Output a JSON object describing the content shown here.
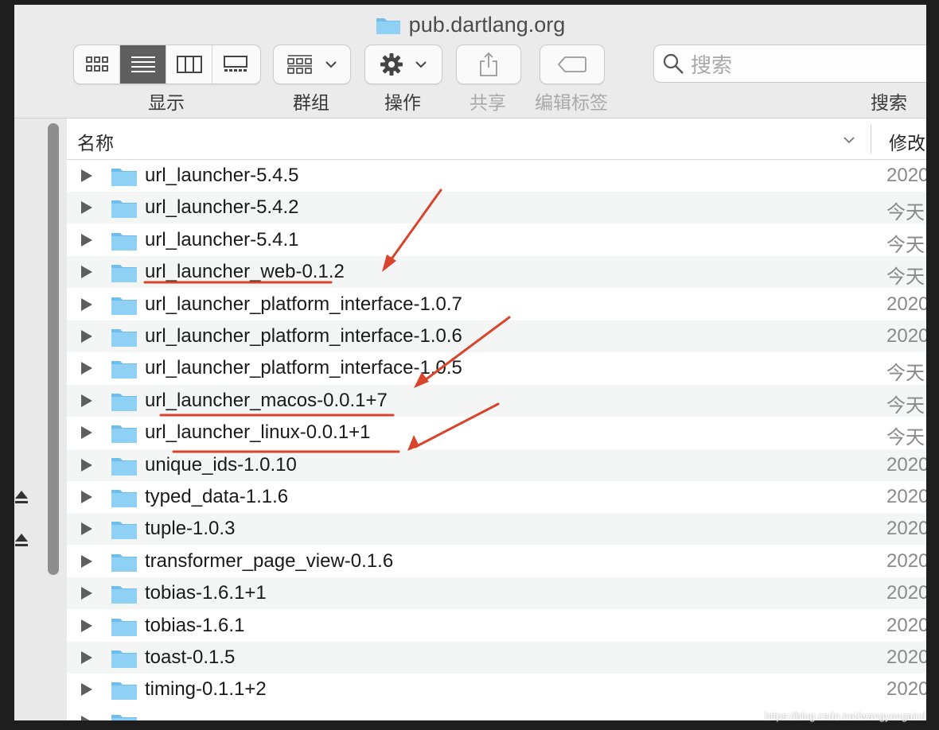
{
  "window": {
    "title": "pub.dartlang.org"
  },
  "toolbar": {
    "view_label": "显示",
    "group_label": "群组",
    "action_label": "操作",
    "share_label": "共享",
    "tags_label": "编辑标签",
    "search_label": "搜索",
    "search_placeholder": "搜索",
    "active_view": "list"
  },
  "columns": {
    "name": "名称",
    "modified": "修改"
  },
  "rows": [
    {
      "name": "url_launcher-5.4.5",
      "date": "2020"
    },
    {
      "name": "url_launcher-5.4.2",
      "date": "今天"
    },
    {
      "name": "url_launcher-5.4.1",
      "date": "今天"
    },
    {
      "name": "url_launcher_web-0.1.2",
      "date": "今天"
    },
    {
      "name": "url_launcher_platform_interface-1.0.7",
      "date": "2020"
    },
    {
      "name": "url_launcher_platform_interface-1.0.6",
      "date": "2020"
    },
    {
      "name": "url_launcher_platform_interface-1.0.5",
      "date": "今天"
    },
    {
      "name": "url_launcher_macos-0.0.1+7",
      "date": "今天"
    },
    {
      "name": "url_launcher_linux-0.0.1+1",
      "date": "今天"
    },
    {
      "name": "unique_ids-1.0.10",
      "date": "2020"
    },
    {
      "name": "typed_data-1.1.6",
      "date": "2020"
    },
    {
      "name": "tuple-1.0.3",
      "date": "2020"
    },
    {
      "name": "transformer_page_view-0.1.6",
      "date": "2020"
    },
    {
      "name": "tobias-1.6.1+1",
      "date": "2020"
    },
    {
      "name": "tobias-1.6.1",
      "date": "2020"
    },
    {
      "name": "toast-0.1.5",
      "date": "2020"
    },
    {
      "name": "timing-0.1.1+2",
      "date": "2020"
    }
  ],
  "colors": {
    "annotation": "#d9442c",
    "folder": "#8fd0f5",
    "folder_tab": "#6fbdec",
    "active_segment": "#5f5f5f"
  },
  "watermark": "https://blog.csdn.net/wangyongaicd"
}
